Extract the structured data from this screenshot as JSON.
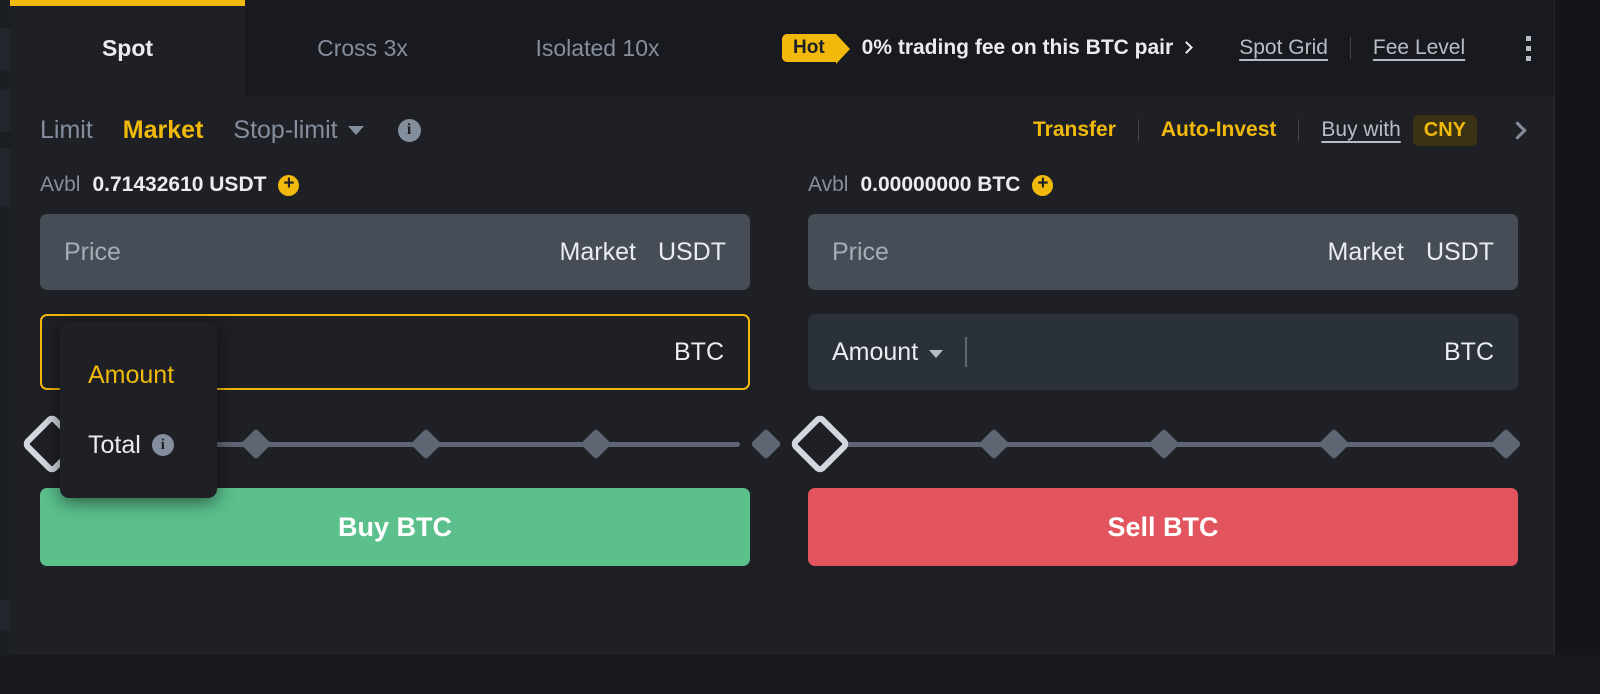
{
  "tabs": [
    {
      "label": "Spot",
      "active": true
    },
    {
      "label": "Cross 3x",
      "active": false
    },
    {
      "label": "Isolated 10x",
      "active": false
    }
  ],
  "header": {
    "hot_badge": "Hot",
    "promo_text": "0% trading fee on this BTC pair",
    "spot_grid": "Spot Grid",
    "fee_level": "Fee Level",
    "accent_color": "#f0b90b"
  },
  "order_types": [
    {
      "label": "Limit",
      "active": false
    },
    {
      "label": "Market",
      "active": true
    },
    {
      "label": "Stop-limit",
      "active": false
    }
  ],
  "order_actions": {
    "transfer": "Transfer",
    "auto_invest": "Auto-Invest",
    "buy_with": "Buy with",
    "currency": "CNY"
  },
  "buy": {
    "avbl_label": "Avbl",
    "avbl_value": "0.71432610 USDT",
    "price_placeholder": "Price",
    "price_mode": "Market",
    "price_unit": "USDT",
    "amount_label": "Amount",
    "amount_value": "",
    "amount_unit": "BTC",
    "slider_percent": 0,
    "slider_stops": [
      0,
      25,
      50,
      75,
      100
    ],
    "button_label": "Buy BTC",
    "button_color": "#5bc08c"
  },
  "sell": {
    "avbl_label": "Avbl",
    "avbl_value": "0.00000000 BTC",
    "price_placeholder": "Price",
    "price_mode": "Market",
    "price_unit": "USDT",
    "amount_label": "Amount",
    "amount_value": "",
    "amount_unit": "BTC",
    "slider_percent": 0,
    "slider_stops": [
      0,
      25,
      50,
      75,
      100
    ],
    "button_label": "Sell BTC",
    "button_color": "#e2555f"
  },
  "dropdown": {
    "open": true,
    "items": [
      {
        "label": "Amount",
        "selected": true,
        "has_info": false
      },
      {
        "label": "Total",
        "selected": false,
        "has_info": true
      }
    ]
  }
}
